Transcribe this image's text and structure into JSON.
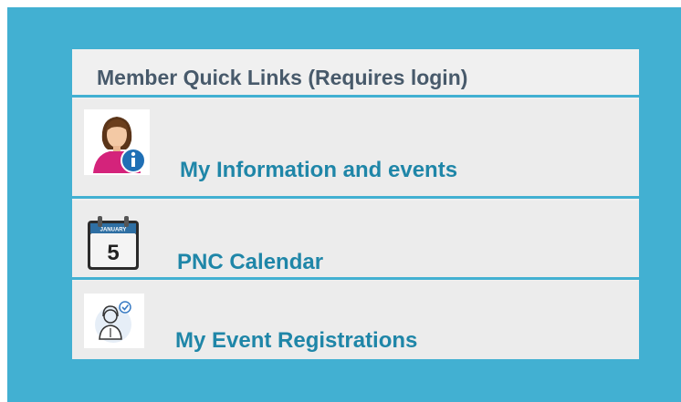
{
  "quick_links": {
    "title": "Member Quick Links (Requires login)",
    "items": [
      {
        "label": "My Information and events",
        "icon": "user-info-icon"
      },
      {
        "label": "PNC Calendar",
        "icon": "calendar-icon",
        "calendar_month": "JANUARY",
        "calendar_day": "5"
      },
      {
        "label": "My Event Registrations",
        "icon": "registration-user-icon"
      }
    ]
  },
  "colors": {
    "frame": "#42b0d2",
    "panel": "#f0f0f0",
    "header_text": "#485a6b",
    "link_text": "#1f86a8",
    "info_badge": "#1f6fb5",
    "avatar_shirt": "#d4237b"
  }
}
